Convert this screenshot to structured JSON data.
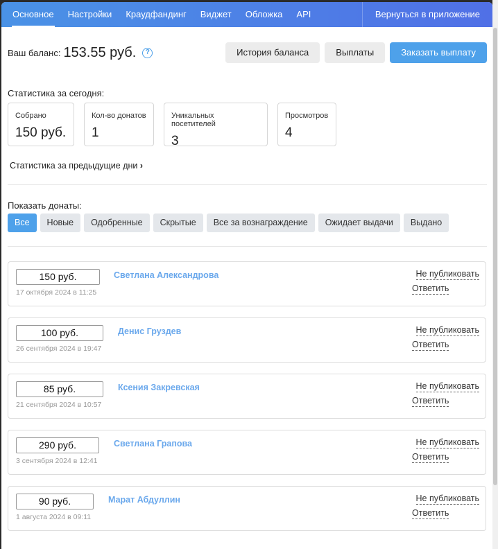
{
  "nav": {
    "tabs": [
      "Основное",
      "Настройки",
      "Краудфандинг",
      "Виджет",
      "Обложка",
      "API"
    ],
    "back": "Вернуться в приложение"
  },
  "balance": {
    "label": "Ваш баланс:",
    "value": "153.55 руб.",
    "help": "?",
    "history": "История баланса",
    "payouts": "Выплаты",
    "order": "Заказать выплату"
  },
  "stats": {
    "title": "Статистика за сегодня:",
    "cards": [
      {
        "label": "Собрано",
        "value": "150 руб."
      },
      {
        "label": "Кол-во донатов",
        "value": "1"
      },
      {
        "label": "Уникальных посетителей",
        "value": "3"
      },
      {
        "label": "Просмотров",
        "value": "4"
      }
    ],
    "prev": "Статистика за предыдущие дни"
  },
  "filter": {
    "title": "Показать донаты:",
    "options": [
      "Все",
      "Новые",
      "Одобренные",
      "Скрытые",
      "Все за вознаграждение",
      "Ожидает выдачи",
      "Выдано"
    ],
    "selected": "Все"
  },
  "actions": {
    "hide": "Не публиковать",
    "reply": "Ответить"
  },
  "donations": [
    {
      "amount": "150 руб.",
      "date": "17 октября 2024 в 11:25",
      "name": "Светлана Александрова"
    },
    {
      "amount": "100 руб.",
      "date": "26 сентября 2024 в 19:47",
      "name": "Денис Груздев"
    },
    {
      "amount": "85 руб.",
      "date": "21 сентября 2024 в 10:57",
      "name": "Ксения Закревская"
    },
    {
      "amount": "290 руб.",
      "date": "3 сентября 2024 в 12:41",
      "name": "Светлана Грапова"
    },
    {
      "amount": "90 руб.",
      "date": "1 августа 2024 в 09:11",
      "name": "Марат Абдуллин"
    }
  ]
}
